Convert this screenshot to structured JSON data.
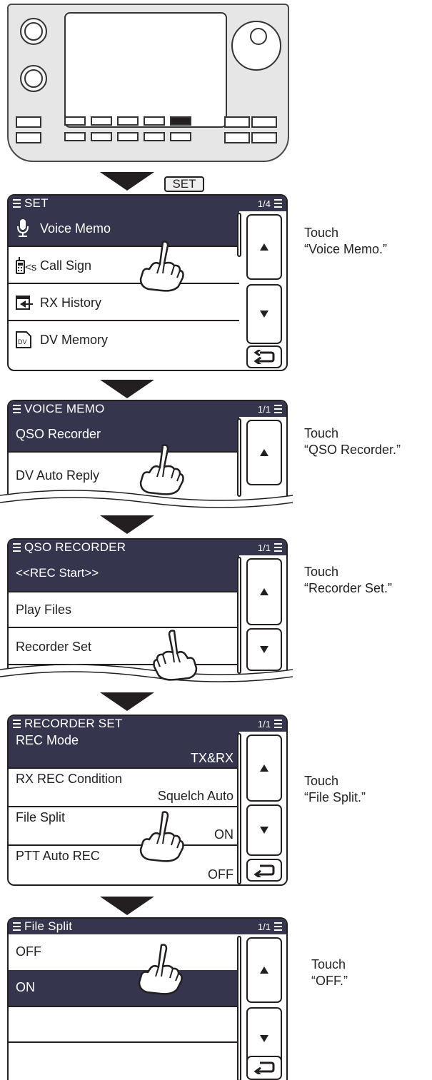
{
  "set_key": "SET",
  "screen1": {
    "title": "SET",
    "page": "1/4",
    "items": [
      {
        "icon": "microphone-icon",
        "label": "Voice Memo"
      },
      {
        "icon": "call-sign-icon",
        "label": "Call Sign"
      },
      {
        "icon": "rx-history-icon",
        "label": "RX History"
      },
      {
        "icon": "dv-memory-icon",
        "label": "DV Memory"
      }
    ],
    "call_sign_prefix": "<s",
    "dv_tag": "DV",
    "selected_index": 0
  },
  "screen2": {
    "title": "VOICE MEMO",
    "page": "1/1",
    "items": [
      {
        "label": "QSO Recorder"
      },
      {
        "label": "DV Auto Reply"
      }
    ],
    "selected_index": 0
  },
  "screen3": {
    "title": "QSO RECORDER",
    "page": "1/1",
    "items": [
      {
        "label": "<<REC Start>>"
      },
      {
        "label": "Play Files"
      },
      {
        "label": "Recorder Set"
      }
    ],
    "selected_index": 0
  },
  "screen4": {
    "title": "RECORDER SET",
    "page": "1/1",
    "items": [
      {
        "label": "REC Mode",
        "value": "TX&RX"
      },
      {
        "label": "RX REC Condition",
        "value": "Squelch Auto"
      },
      {
        "label": "File Split",
        "value": "ON"
      },
      {
        "label": "PTT Auto REC",
        "value": "OFF"
      }
    ],
    "selected_index": 0
  },
  "screen5": {
    "title": "File Split",
    "page": "1/1",
    "items": [
      {
        "label": "OFF"
      },
      {
        "label": "ON"
      }
    ],
    "selected_index": 1
  },
  "captions": [
    {
      "line1": "Touch",
      "line2": "“Voice Memo.”"
    },
    {
      "line1": "Touch",
      "line2": "“QSO Recorder.”"
    },
    {
      "line1": "Touch",
      "line2": "“Recorder Set.”"
    },
    {
      "line1": "Touch",
      "line2": "“File Split.”"
    },
    {
      "line1": "Touch",
      "line2": "“OFF.”"
    }
  ],
  "colors": {
    "header": "#35354e",
    "ink": "#231f20"
  }
}
